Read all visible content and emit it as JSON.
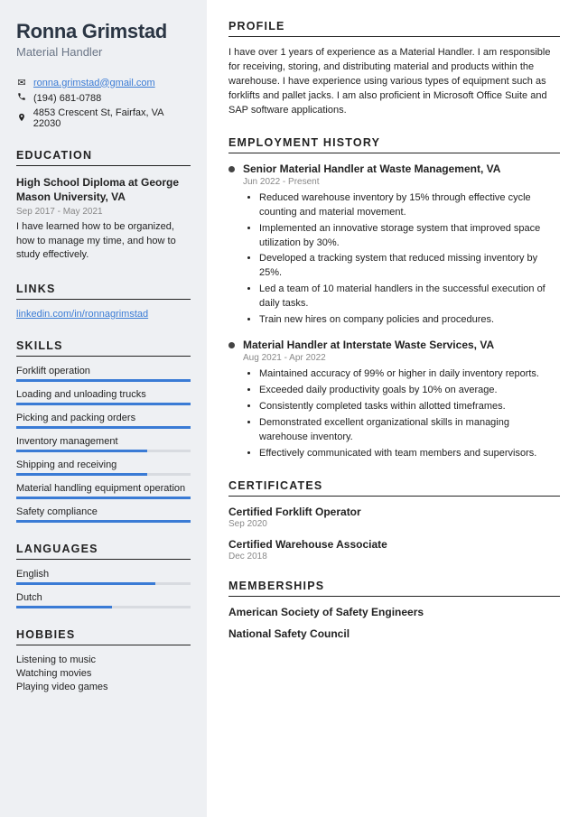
{
  "name": "Ronna Grimstad",
  "title": "Material Handler",
  "contact": {
    "email": "ronna.grimstad@gmail.com",
    "phone": "(194) 681-0788",
    "address": "4853 Crescent St, Fairfax, VA 22030"
  },
  "sections": {
    "education": "EDUCATION",
    "links": "LINKS",
    "skills": "SKILLS",
    "languages": "LANGUAGES",
    "hobbies": "HOBBIES",
    "profile": "PROFILE",
    "employment": "EMPLOYMENT HISTORY",
    "certificates": "CERTIFICATES",
    "memberships": "MEMBERSHIPS"
  },
  "education": {
    "title": "High School Diploma at George Mason University, VA",
    "dates": "Sep 2017 - May 2021",
    "desc": "I have learned how to be organized, how to manage my time, and how to study effectively."
  },
  "links": [
    {
      "label": "linkedin.com/in/ronnagrimstad"
    }
  ],
  "skills": [
    {
      "label": "Forklift operation",
      "pct": 100
    },
    {
      "label": "Loading and unloading trucks",
      "pct": 100
    },
    {
      "label": "Picking and packing orders",
      "pct": 100
    },
    {
      "label": "Inventory management",
      "pct": 75
    },
    {
      "label": "Shipping and receiving",
      "pct": 75
    },
    {
      "label": "Material handling equipment operation",
      "pct": 100
    },
    {
      "label": "Safety compliance",
      "pct": 100
    }
  ],
  "languages": [
    {
      "label": "English",
      "pct": 80
    },
    {
      "label": "Dutch",
      "pct": 55
    }
  ],
  "hobbies": [
    "Listening to music",
    "Watching movies",
    "Playing video games"
  ],
  "profile": "I have over 1 years of experience as a Material Handler. I am responsible for receiving, storing, and distributing material and products within the warehouse. I have experience using various types of equipment such as forklifts and pallet jacks. I am also proficient in Microsoft Office Suite and SAP software applications.",
  "jobs": [
    {
      "title": "Senior Material Handler at Waste Management, VA",
      "dates": "Jun 2022 - Present",
      "bullets": [
        "Reduced warehouse inventory by 15% through effective cycle counting and material movement.",
        "Implemented an innovative storage system that improved space utilization by 30%.",
        "Developed a tracking system that reduced missing inventory by 25%.",
        "Led a team of 10 material handlers in the successful execution of daily tasks.",
        "Train new hires on company policies and procedures."
      ]
    },
    {
      "title": "Material Handler at Interstate Waste Services, VA",
      "dates": "Aug 2021 - Apr 2022",
      "bullets": [
        "Maintained accuracy of 99% or higher in daily inventory reports.",
        "Exceeded daily productivity goals by 10% on average.",
        "Consistently completed tasks within allotted timeframes.",
        "Demonstrated excellent organizational skills in managing warehouse inventory.",
        "Effectively communicated with team members and supervisors."
      ]
    }
  ],
  "certificates": [
    {
      "title": "Certified Forklift Operator",
      "date": "Sep 2020"
    },
    {
      "title": "Certified Warehouse Associate",
      "date": "Dec 2018"
    }
  ],
  "memberships": [
    "American Society of Safety Engineers",
    "National Safety Council"
  ]
}
